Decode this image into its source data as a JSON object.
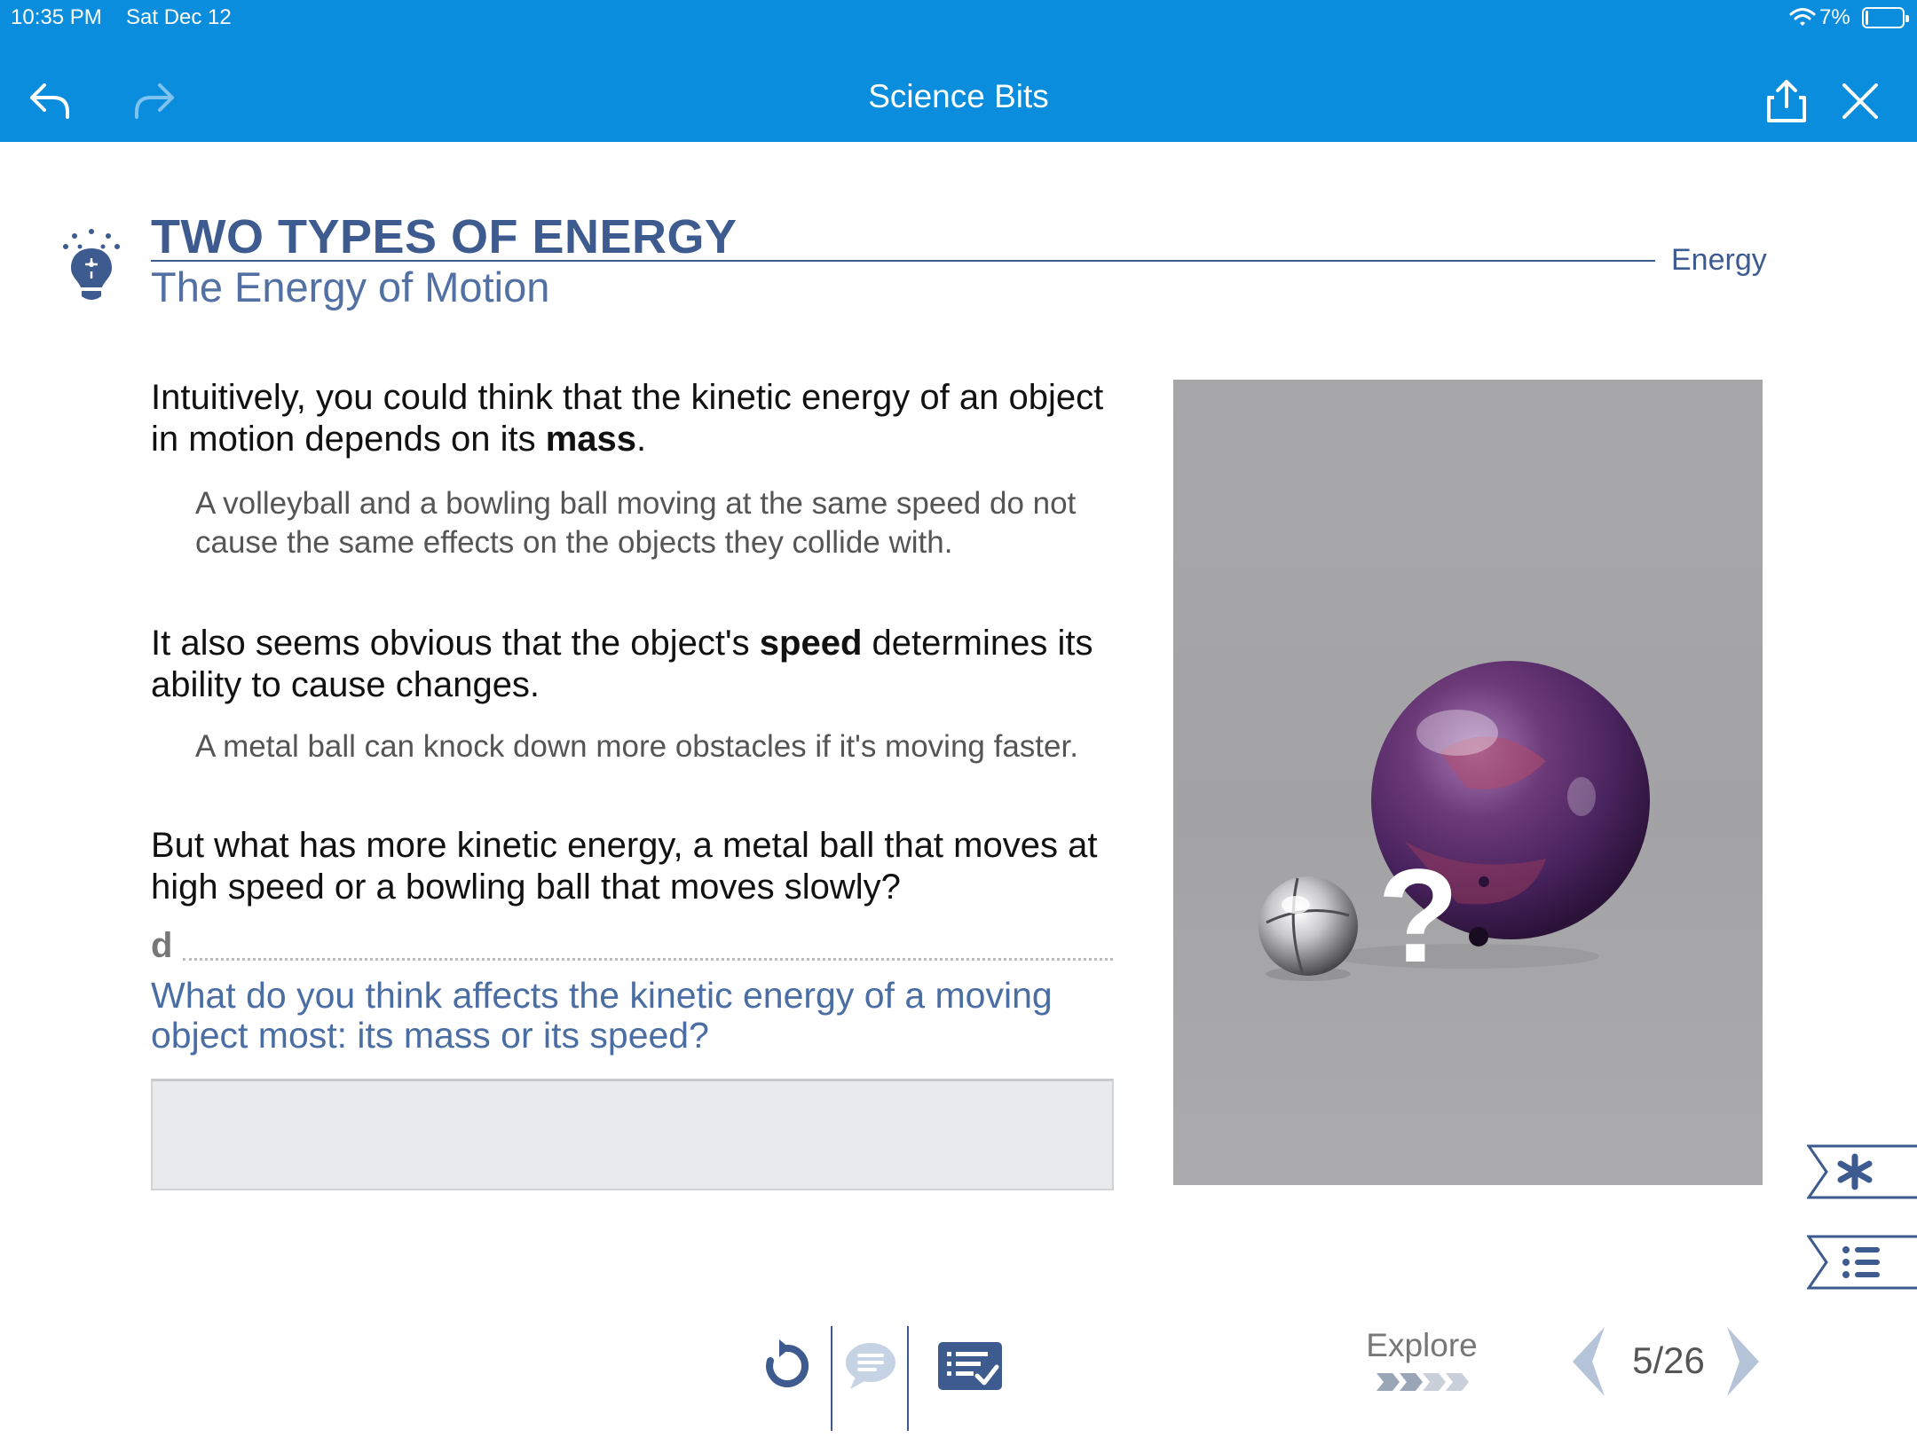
{
  "status_bar": {
    "time": "10:35 PM",
    "date": "Sat Dec 12",
    "battery": "7%",
    "battery_level": 0.07
  },
  "app_bar": {
    "title": "Science Bits",
    "back_icon": "undo-arrow-icon",
    "forward_icon": "redo-arrow-icon",
    "share_icon": "share-icon",
    "close_icon": "close-icon",
    "color": "#0a8ddd"
  },
  "header": {
    "title": "TWO TYPES OF ENERGY",
    "subtitle": "The Energy of Motion",
    "section": "Energy",
    "icon": "lightbulb-puzzle-icon",
    "accent": "#3d5b8f"
  },
  "content": {
    "p1": {
      "before": "Intuitively, you could think that the kinetic energy of an object in motion depends on its ",
      "bold": "mass",
      "after": "."
    },
    "note1": "A volleyball and a bowling ball moving at the same speed do not cause the same effects on the objects they collide with.",
    "p2": {
      "before": "It also seems obvious that the object's ",
      "bold": "speed",
      "after": " determines its ability to cause changes."
    },
    "note2": "A metal ball can knock down more obstacles if it's moving faster.",
    "p3": "But what has more kinetic energy, a metal ball that moves at high speed or a bowling ball that moves slowly?",
    "activity_letter": "d",
    "question": "What do you think affects the kinetic energy of a moving object most: its mass or its speed?",
    "answer_value": ""
  },
  "photo": {
    "question_mark": "?"
  },
  "side_tabs": {
    "star_icon": "asterisk-icon",
    "index_icon": "list-icon"
  },
  "footer": {
    "reset_icon": "reset-icon",
    "comment_icon": "comment-icon",
    "tasks_icon": "task-list-icon",
    "explore_label": "Explore",
    "explore_progress": 2,
    "explore_steps": 4,
    "page_current": "5",
    "page_total": "/26"
  }
}
